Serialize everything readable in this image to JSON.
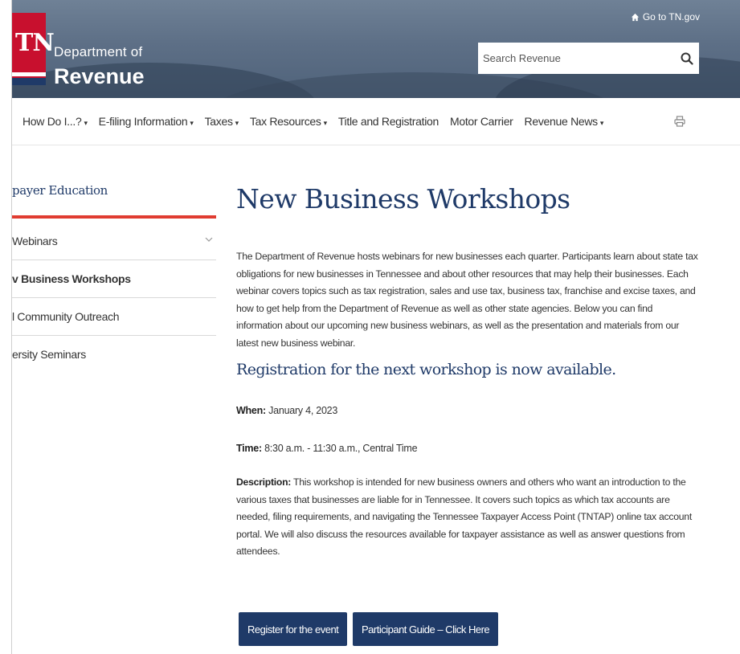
{
  "header": {
    "logo_text": "TN",
    "department_of": "Department of",
    "department_name": "Revenue",
    "goto_label": "Go to TN.gov",
    "search": {
      "placeholder": "Search Revenue"
    }
  },
  "nav": {
    "items": [
      {
        "label": "How Do I...?",
        "dropdown": true
      },
      {
        "label": "E-filing Information",
        "dropdown": true
      },
      {
        "label": "Taxes",
        "dropdown": true
      },
      {
        "label": "Tax Resources",
        "dropdown": true
      },
      {
        "label": "Title and Registration",
        "dropdown": false
      },
      {
        "label": "Motor Carrier",
        "dropdown": false
      },
      {
        "label": "Revenue News",
        "dropdown": true
      }
    ],
    "caret": "▾"
  },
  "sidebar": {
    "title": "payer Education",
    "items": [
      {
        "label": "Webinars",
        "expandable": true
      },
      {
        "label": "v Business Workshops",
        "active": true
      },
      {
        "label": "l Community Outreach"
      },
      {
        "label": "ersity Seminars"
      }
    ]
  },
  "main": {
    "title": "New Business Workshops",
    "intro": "The Department of Revenue hosts webinars for new businesses each quarter. Participants learn about state tax obligations for new businesses in Tennessee and about other resources that may help their businesses. Each webinar covers topics such as tax registration, sales and use tax, business tax, franchise and excise taxes, and how to get help from the Department of Revenue as well as other state agencies.  Below you can find information about our upcoming new business webinars, as well as the presentation and materials from our latest new business webinar.",
    "subheading": "Registration for the next workshop is now available.",
    "when": {
      "label": "When:",
      "value": "January 4, 2023"
    },
    "time": {
      "label": "Time:",
      "value": "8:30 a.m. - 11:30 a.m., Central Time"
    },
    "description": {
      "label": "Description:",
      "value": "This workshop is intended for new business owners and others who want an introduction to the various taxes that businesses are liable for in Tennessee. It covers such topics as which tax accounts are needed, filing requirements, and navigating the Tennessee Taxpayer Access Point (TNTAP) online tax account portal. We will also discuss the resources available for taxpayer assistance as well as answer questions from attendees."
    },
    "buttons": {
      "register": "Register for the event",
      "guide": "Participant Guide – Click Here"
    }
  },
  "colors": {
    "navy": "#1f3a68",
    "brand_red": "#c8102e",
    "accent_red": "#e03c31",
    "header_bg": "#5d6f86"
  }
}
